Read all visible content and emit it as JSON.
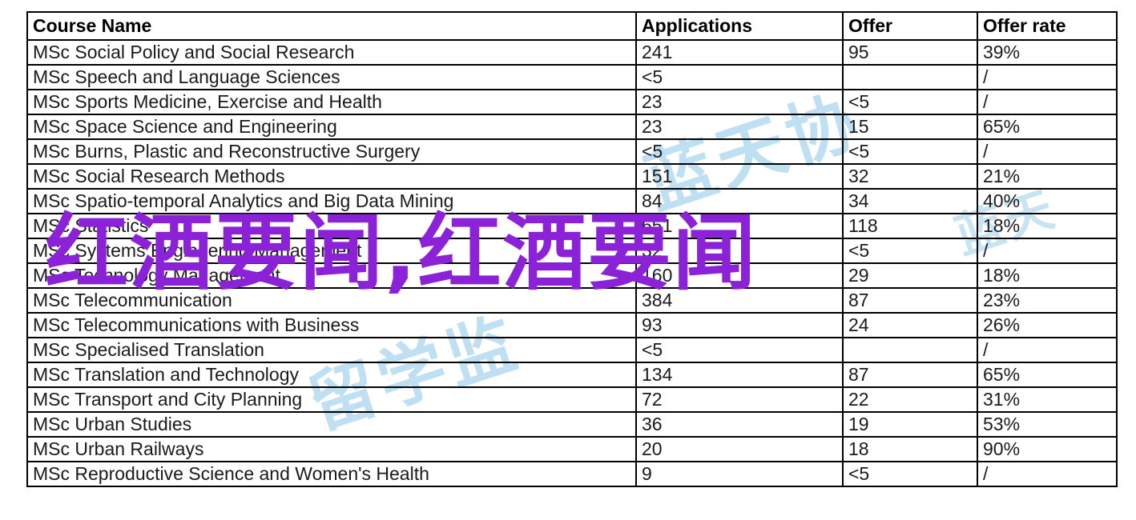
{
  "table": {
    "columns": [
      "Course Name",
      "Applications",
      "Offer",
      "Offer rate"
    ],
    "rows": [
      {
        "course": "MSc Social Policy and Social Research",
        "applications": "241",
        "offer": "95",
        "offer_rate": "39%"
      },
      {
        "course": "MSc Speech and Language Sciences",
        "applications": "<5",
        "offer": "",
        "offer_rate": "/"
      },
      {
        "course": "MSc Sports Medicine, Exercise and Health",
        "applications": "23",
        "offer": "<5",
        "offer_rate": "/"
      },
      {
        "course": "MSc Space Science and Engineering",
        "applications": "23",
        "offer": "15",
        "offer_rate": "65%"
      },
      {
        "course": "MSc Burns, Plastic and Reconstructive Surgery",
        "applications": "<5",
        "offer": "<5",
        "offer_rate": "/"
      },
      {
        "course": "MSc Social Research Methods",
        "applications": "151",
        "offer": "32",
        "offer_rate": "21%"
      },
      {
        "course": "MSc Spatio-temporal Analytics and Big Data Mining",
        "applications": "84",
        "offer": "34",
        "offer_rate": "40%"
      },
      {
        "course": "MSc Statistics",
        "applications": "651",
        "offer": "118",
        "offer_rate": "18%"
      },
      {
        "course": "MSc Systems Engineering Management",
        "applications": "32",
        "offer": "<5",
        "offer_rate": "/"
      },
      {
        "course": "MSc Technology Management",
        "applications": "160",
        "offer": "29",
        "offer_rate": "18%"
      },
      {
        "course": "MSc Telecommunication",
        "applications": "384",
        "offer": "87",
        "offer_rate": "23%"
      },
      {
        "course": "MSc Telecommunications with Business",
        "applications": "93",
        "offer": "24",
        "offer_rate": "26%"
      },
      {
        "course": "MSc Specialised Translation",
        "applications": "<5",
        "offer": "",
        "offer_rate": "/"
      },
      {
        "course": "MSc Translation and Technology",
        "applications": "134",
        "offer": "87",
        "offer_rate": "65%"
      },
      {
        "course": "MSc Transport and City Planning",
        "applications": "72",
        "offer": "22",
        "offer_rate": "31%"
      },
      {
        "course": "MSc Urban Studies",
        "applications": "36",
        "offer": "19",
        "offer_rate": "53%"
      },
      {
        "course": "MSc Urban Railways",
        "applications": "20",
        "offer": "18",
        "offer_rate": "90%"
      },
      {
        "course": "MSc Reproductive Science and Women's Health",
        "applications": "9",
        "offer": "<5",
        "offer_rate": "/"
      }
    ]
  },
  "overlay": {
    "purple_text": "红酒要闻,红酒要闻",
    "purple_color": "#8B22D8"
  },
  "watermarks": {
    "blue_color": "#bfe0f2",
    "marks": [
      "蓝天协",
      "留学监",
      "蓝天"
    ]
  }
}
